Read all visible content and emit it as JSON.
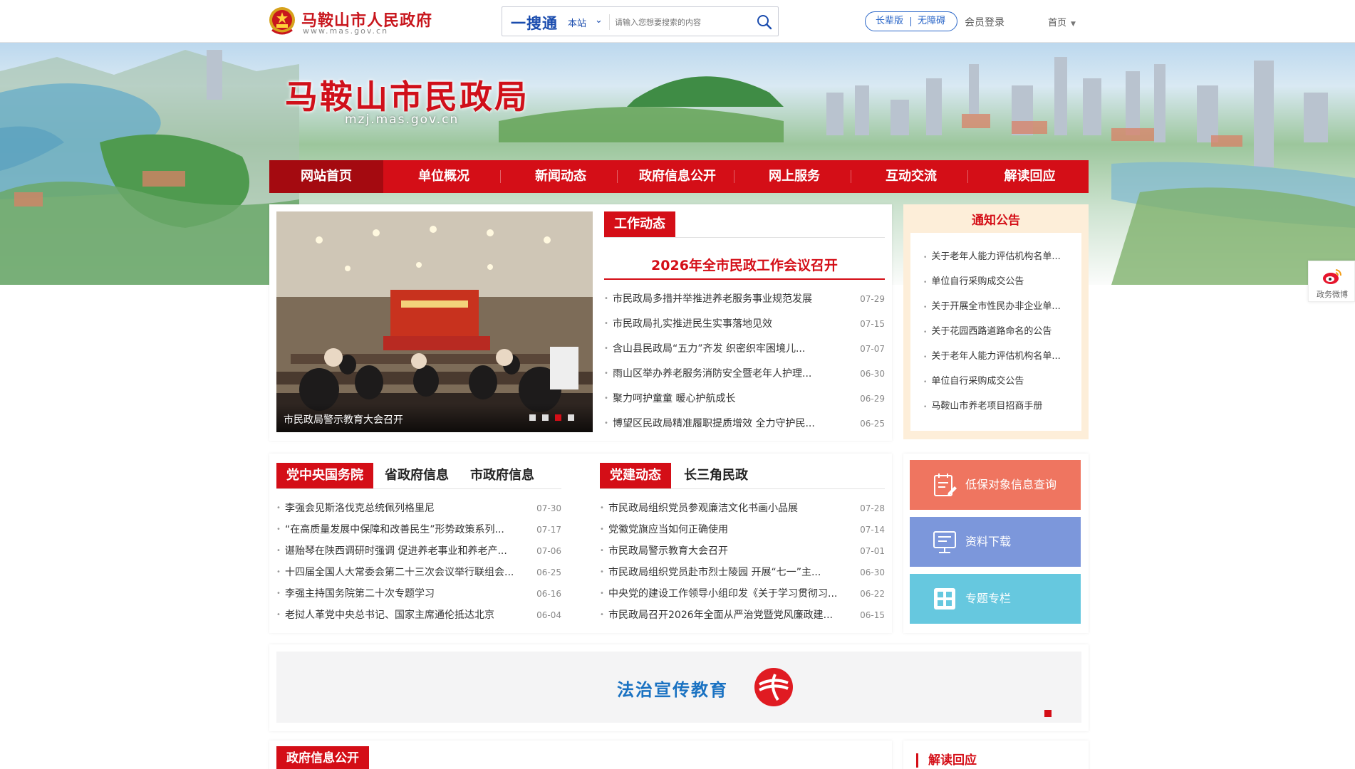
{
  "header": {
    "site_title": "马鞍山市人民政府",
    "site_url": "www.mas.gov.cn",
    "search_brand": "一搜通",
    "search_scope": "本站",
    "search_placeholder": "请输入您想要搜索的内容",
    "access_elder": "长辈版",
    "access_barrier_free": "无障碍",
    "member_login": "会员登录",
    "home_select": "首页"
  },
  "banner": {
    "title": "马鞍山市民政局",
    "subtitle": "mzj.mas.gov.cn"
  },
  "nav": {
    "items": [
      "网站首页",
      "单位概况",
      "新闻动态",
      "政府信息公开",
      "网上服务",
      "互动交流",
      "解读回应"
    ]
  },
  "slider": {
    "caption": "市民政局警示教育大会召开",
    "page_count": 4,
    "current_page": 3
  },
  "work": {
    "tab": "工作动态",
    "headline": "2026年全市民政工作会议召开",
    "items": [
      {
        "title": "市民政局多措并举推进养老服务事业规范发展",
        "date": "07-29"
      },
      {
        "title": "市民政局扎实推进民生实事落地见效",
        "date": "07-15"
      },
      {
        "title": "含山县民政局“五力”齐发 织密织牢困境儿...",
        "date": "07-07"
      },
      {
        "title": "雨山区举办养老服务消防安全暨老年人护理...",
        "date": "06-30"
      },
      {
        "title": "聚力呵护童童 暖心护航成长",
        "date": "06-29"
      },
      {
        "title": "博望区民政局精准履职提质增效 全力守护民...",
        "date": "06-25"
      }
    ]
  },
  "notice": {
    "title": "通知公告",
    "items": [
      "关于老年人能力评估机构名单...",
      "单位自行采购成交公告",
      "关于开展全市性民办非企业单...",
      "关于花园西路道路命名的公告",
      "关于老年人能力评估机构名单...",
      "单位自行采购成交公告",
      "马鞍山市养老项目招商手册"
    ]
  },
  "gov_news": {
    "tabs": [
      "党中央国务院",
      "省政府信息",
      "市政府信息"
    ],
    "items": [
      {
        "title": "李强会见斯洛伐克总统佩列格里尼",
        "date": "07-30"
      },
      {
        "title": "“在高质量发展中保障和改善民生”形势政策系列...",
        "date": "07-17"
      },
      {
        "title": "谌贻琴在陕西调研时强调 促进养老事业和养老产...",
        "date": "07-06"
      },
      {
        "title": "十四届全国人大常委会第二十三次会议举行联组会...",
        "date": "06-25"
      },
      {
        "title": "李强主持国务院第二十次专题学习",
        "date": "06-16"
      },
      {
        "title": "老挝人革党中央总书记、国家主席通伦抵达北京",
        "date": "06-04"
      }
    ]
  },
  "party_news": {
    "tabs": [
      "党建动态",
      "长三角民政"
    ],
    "items": [
      {
        "title": "市民政局组织党员参观廉洁文化书画小品展",
        "date": "07-28"
      },
      {
        "title": "党徽党旗应当如何正确使用",
        "date": "07-14"
      },
      {
        "title": "市民政局警示教育大会召开",
        "date": "07-01"
      },
      {
        "title": "市民政局组织党员赴市烈士陵园 开展“七一”主...",
        "date": "06-30"
      },
      {
        "title": "中央党的建设工作领导小组印发《关于学习贯彻习...",
        "date": "06-22"
      },
      {
        "title": "市民政局召开2026年全面从严治党暨党风廉政建...",
        "date": "06-15"
      }
    ]
  },
  "quick_links": [
    {
      "label": "低保对象信息查询",
      "color": "#ef7560",
      "icon": "form-query-icon"
    },
    {
      "label": "资料下载",
      "color": "#7c97db",
      "icon": "monitor-download-icon"
    },
    {
      "label": "专题专栏",
      "color": "#66c8df",
      "icon": "grid-column-icon"
    }
  ],
  "law": {
    "title": "法治宣传教育"
  },
  "sidebar": {
    "weibo_label": "政务微博"
  },
  "bottom": {
    "left_tab": "政府信息公开",
    "right_title": "解读回应"
  },
  "colors": {
    "primary_red": "#d40e17",
    "brand_blue": "#1a4cae",
    "notice_bg": "#fdeed9"
  }
}
